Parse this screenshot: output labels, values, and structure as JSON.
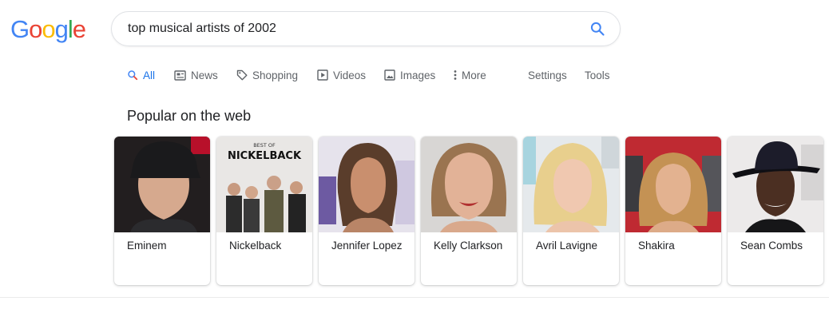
{
  "logo": {
    "letters": [
      "G",
      "o",
      "o",
      "g",
      "l",
      "e"
    ],
    "colors": [
      "#4285F4",
      "#EA4335",
      "#FBBC05",
      "#4285F4",
      "#34A853",
      "#EA4335"
    ]
  },
  "search": {
    "query": "top musical artists of 2002",
    "icon": "search-icon"
  },
  "tabs": [
    {
      "label": "All",
      "icon": "search-icon",
      "active": true
    },
    {
      "label": "News",
      "icon": "news-icon"
    },
    {
      "label": "Shopping",
      "icon": "tag-icon"
    },
    {
      "label": "Videos",
      "icon": "video-icon"
    },
    {
      "label": "Images",
      "icon": "image-icon"
    },
    {
      "label": "More",
      "icon": "more-icon"
    },
    {
      "label": "Settings"
    },
    {
      "label": "Tools"
    }
  ],
  "section": {
    "title": "Popular on the web"
  },
  "overlay_texts": {
    "nickelback_small": "BEST OF",
    "nickelback_big": "NICKELBACK"
  },
  "artists": [
    {
      "name": "Eminem"
    },
    {
      "name": "Nickelback"
    },
    {
      "name": "Jennifer Lopez"
    },
    {
      "name": "Kelly Clarkson"
    },
    {
      "name": "Avril Lavigne"
    },
    {
      "name": "Shakira"
    },
    {
      "name": "Sean Combs"
    }
  ],
  "colors": {
    "accent": "#1a73e8",
    "text_secondary": "#5f6368"
  }
}
